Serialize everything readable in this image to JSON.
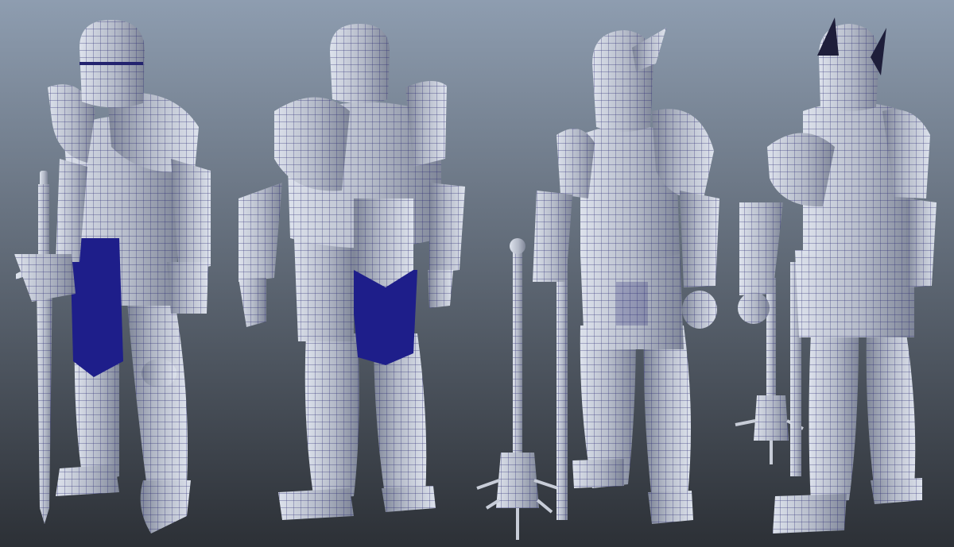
{
  "viewport": {
    "background_top": "#8e9db0",
    "background_bottom": "#2c3036"
  },
  "material": {
    "metal_light": "#dde2ec",
    "metal_mid": "#b4bac8",
    "metal_dark": "#7f8698",
    "wire": "#23236e",
    "mail": "#1e1e8a"
  },
  "models": [
    {
      "name": "knight-front-three-quarter",
      "weapon": "sword"
    },
    {
      "name": "knight-back-left",
      "weapon": "none"
    },
    {
      "name": "knight-front-right",
      "weapon": "mace"
    },
    {
      "name": "knight-back-right",
      "weapon": "mace"
    }
  ]
}
